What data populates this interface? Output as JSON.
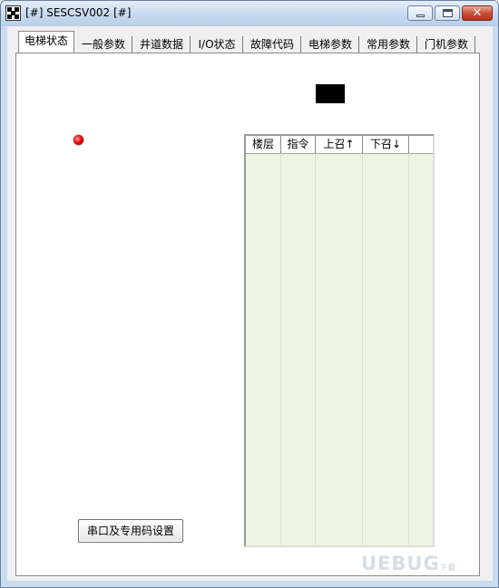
{
  "window": {
    "title": "[#] SESCSV002 [#]"
  },
  "tabs": [
    {
      "label": "电梯状态",
      "active": true
    },
    {
      "label": "一般参数"
    },
    {
      "label": "井道数据"
    },
    {
      "label": "I/O状态"
    },
    {
      "label": "故障代码"
    },
    {
      "label": "电梯参数"
    },
    {
      "label": "常用参数"
    },
    {
      "label": "门机参数"
    }
  ],
  "status": {
    "led_color": "#e00000",
    "floor_display_text": ""
  },
  "floor_table": {
    "columns": [
      "楼层",
      "指令",
      "上召↑",
      "下召↓"
    ],
    "rows": []
  },
  "buttons": {
    "port_settings": "串口及专用码设置"
  },
  "watermark": "UEBUG",
  "watermark_sub": "下载"
}
